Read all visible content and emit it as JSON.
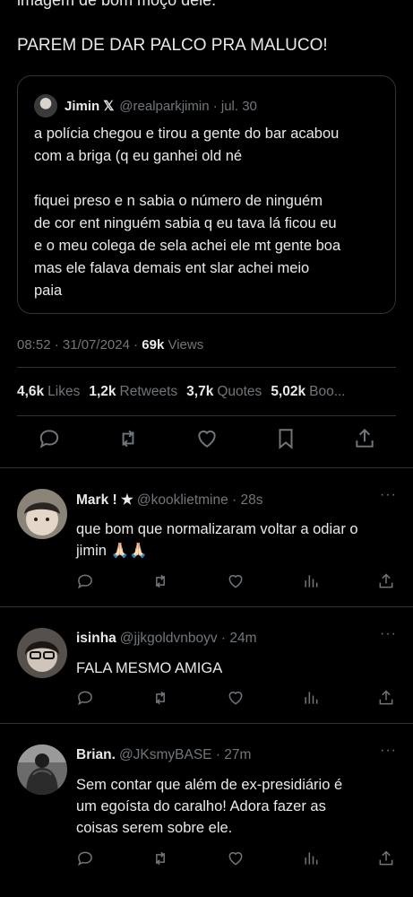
{
  "main": {
    "top_partial": "imagem de bom moço dele.",
    "text": "PAREM DE DAR PALCO PRA MALUCO!"
  },
  "quote": {
    "name": "Jimin",
    "badge": "𝕏",
    "handle": "@realparkjimin · jul. 30",
    "body": "a polícia chegou e tirou a gente do bar acabou\ncom a briga (q eu ganhei old né\n\nfiquei preso e n sabia o número de ninguém\nde cor ent ninguém sabia q eu tava lá ficou eu\ne o meu colega de sela achei ele mt gente boa\nmas ele falava demais ent slar achei meio\npaia"
  },
  "meta": {
    "time": "08:52 · 31/07/2024 · ",
    "views_count": "69k",
    "views_label": " Views"
  },
  "stats": [
    {
      "count": "4,6k",
      "label": "Likes"
    },
    {
      "count": "1,2k",
      "label": "Retweets"
    },
    {
      "count": "3,7k",
      "label": "Quotes"
    },
    {
      "count": "5,02k",
      "label": "Boo..."
    }
  ],
  "replies": [
    {
      "name": "Mark ! ★",
      "handle": "@kooklietmine · 28s",
      "text": "que bom que normalizaram voltar a odiar o\njimin 🙏🏻🙏🏻"
    },
    {
      "name": "isinha",
      "handle": "@jjkgoldvnboyv · 24m",
      "text": "FALA MESMO AMIGA"
    },
    {
      "name": "Brian.",
      "handle": "@JKsmyBASE · 27m",
      "text": "Sem contar que além de ex-presidiário é\num egoísta do caralho! Adora fazer as\ncoisas serem sobre ele."
    }
  ],
  "more_label": "···"
}
